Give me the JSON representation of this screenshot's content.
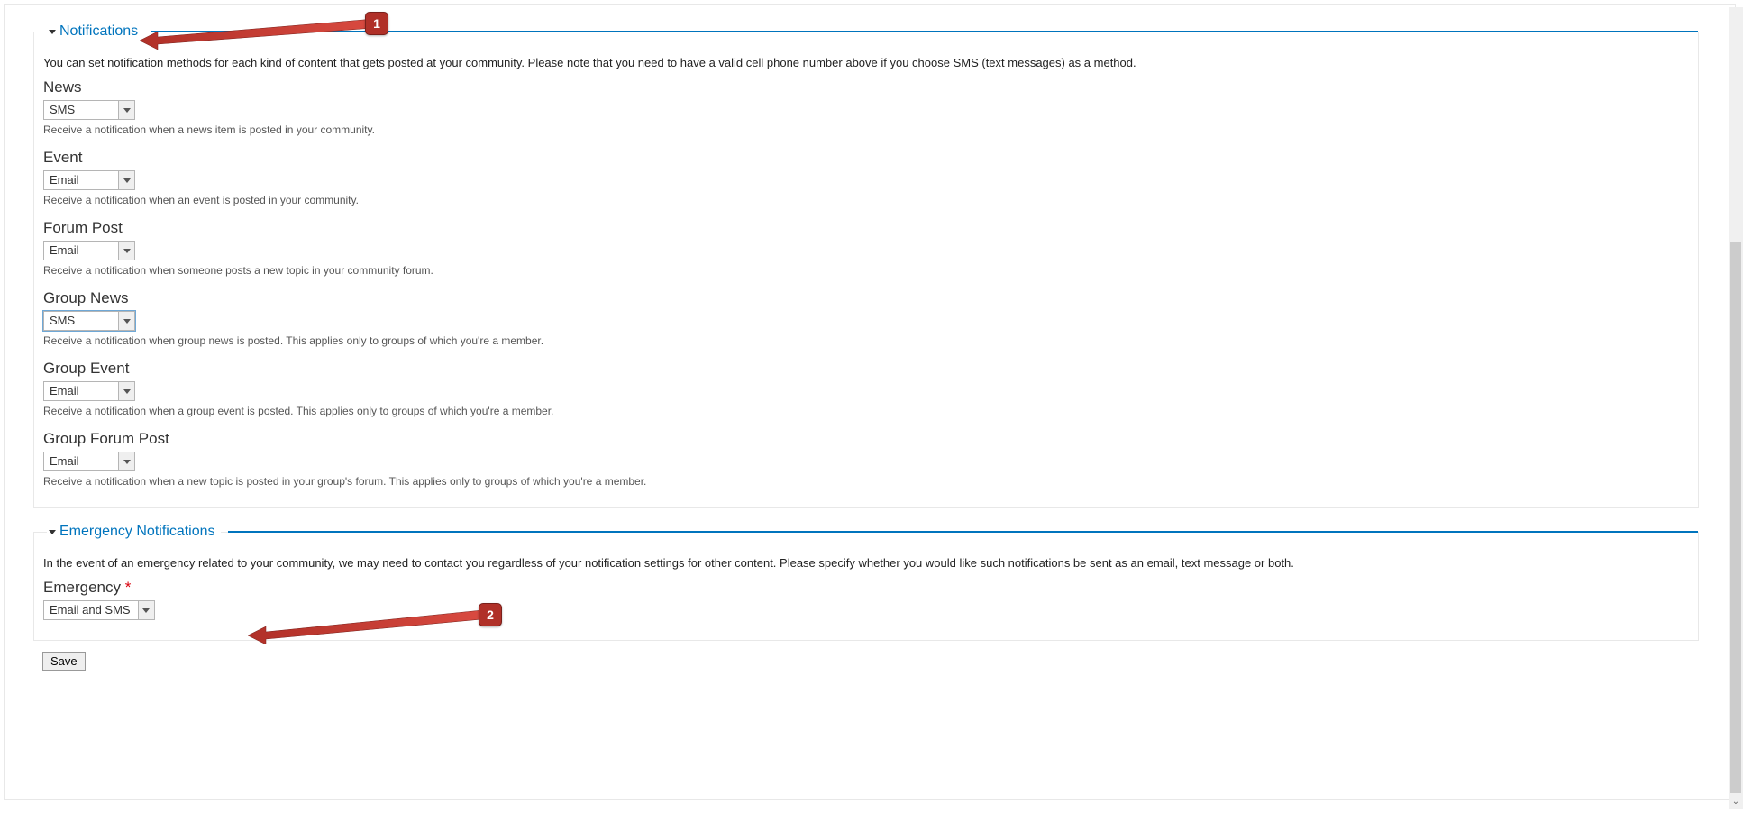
{
  "annotations": {
    "badge1": "1",
    "badge2": "2"
  },
  "notifications": {
    "legend": "Notifications",
    "description": "You can set notification methods for each kind of content that gets posted at your community. Please note that you need to have a valid cell phone number above if you choose SMS (text messages) as a method.",
    "fields": {
      "news": {
        "label": "News",
        "value": "SMS",
        "help": "Receive a notification when a news item is posted in your community."
      },
      "event": {
        "label": "Event",
        "value": "Email",
        "help": "Receive a notification when an event is posted in your community."
      },
      "forum_post": {
        "label": "Forum Post",
        "value": "Email",
        "help": "Receive a notification when someone posts a new topic in your community forum."
      },
      "group_news": {
        "label": "Group News",
        "value": "SMS",
        "help": "Receive a notification when group news is posted. This applies only to groups of which you're a member."
      },
      "group_event": {
        "label": "Group Event",
        "value": "Email",
        "help": "Receive a notification when a group event is posted. This applies only to groups of which you're a member."
      },
      "group_forum_post": {
        "label": "Group Forum Post",
        "value": "Email",
        "help": "Receive a notification when a new topic is posted in your group's forum. This applies only to groups of which you're a member."
      }
    }
  },
  "emergency": {
    "legend": "Emergency Notifications",
    "description": "In the event of an emergency related to your community, we may need to contact you regardless of your notification settings for other content. Please specify whether you would like such notifications be sent as an email, text message or both.",
    "field": {
      "label": "Emergency",
      "required_mark": "*",
      "value": "Email and SMS"
    }
  },
  "buttons": {
    "save": "Save"
  }
}
